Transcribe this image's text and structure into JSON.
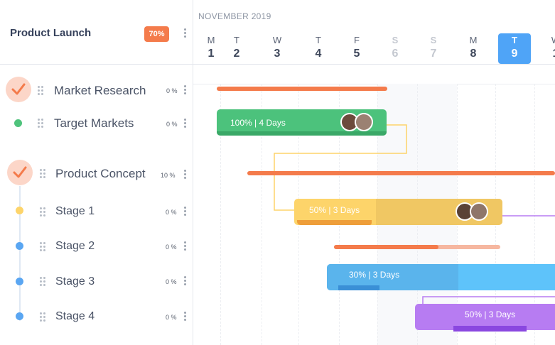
{
  "project": {
    "title": "Product Launch",
    "progress": "70%"
  },
  "timeline": {
    "month": "NOVEMBER 2019",
    "days": [
      {
        "letter": "M",
        "num": "1",
        "weekend": false
      },
      {
        "letter": "T",
        "num": "2",
        "weekend": false
      },
      {
        "letter": "W",
        "num": "3",
        "weekend": false
      },
      {
        "letter": "T",
        "num": "4",
        "weekend": false
      },
      {
        "letter": "F",
        "num": "5",
        "weekend": false
      },
      {
        "letter": "S",
        "num": "6",
        "weekend": true
      },
      {
        "letter": "S",
        "num": "7",
        "weekend": true
      },
      {
        "letter": "M",
        "num": "8",
        "weekend": false
      },
      {
        "letter": "T",
        "num": "9",
        "weekend": false,
        "today": true
      },
      {
        "letter": "W",
        "num": "1",
        "weekend": false
      }
    ]
  },
  "tasks": [
    {
      "name": "Market Research",
      "pct": "0 %",
      "kind": "group",
      "status": "done"
    },
    {
      "name": "Target Markets",
      "pct": "0 %",
      "kind": "sub",
      "dot_color": "#4fc37c"
    },
    {
      "name": "Product Concept",
      "pct": "10 %",
      "kind": "group",
      "status": "done"
    },
    {
      "name": "Stage 1",
      "pct": "0 %",
      "kind": "sub",
      "dot_color": "#fdd46a"
    },
    {
      "name": "Stage 2",
      "pct": "0 %",
      "kind": "sub",
      "dot_color": "#5aa6f2"
    },
    {
      "name": "Stage 3",
      "pct": "0 %",
      "kind": "sub",
      "dot_color": "#5aa6f2"
    },
    {
      "name": "Stage 4",
      "pct": "0 %",
      "kind": "sub",
      "dot_color": "#5aa6f2"
    }
  ],
  "bars": {
    "target_markets": {
      "label": "100% | 4 Days",
      "color": "#4cc27c",
      "progress": 1.0
    },
    "stage1": {
      "label": "50% | 3 Days",
      "color": "#fdd46a",
      "progress": 0.5
    },
    "stage3": {
      "label": "30% | 3 Days",
      "color": "#5ec3fa",
      "progress": 0.3
    },
    "stage4": {
      "label": "50% | 3 Days",
      "color": "#b77cf2",
      "progress": 0.5
    }
  },
  "colors": {
    "accent": "#f47b4b",
    "today": "#4fa4f7"
  }
}
